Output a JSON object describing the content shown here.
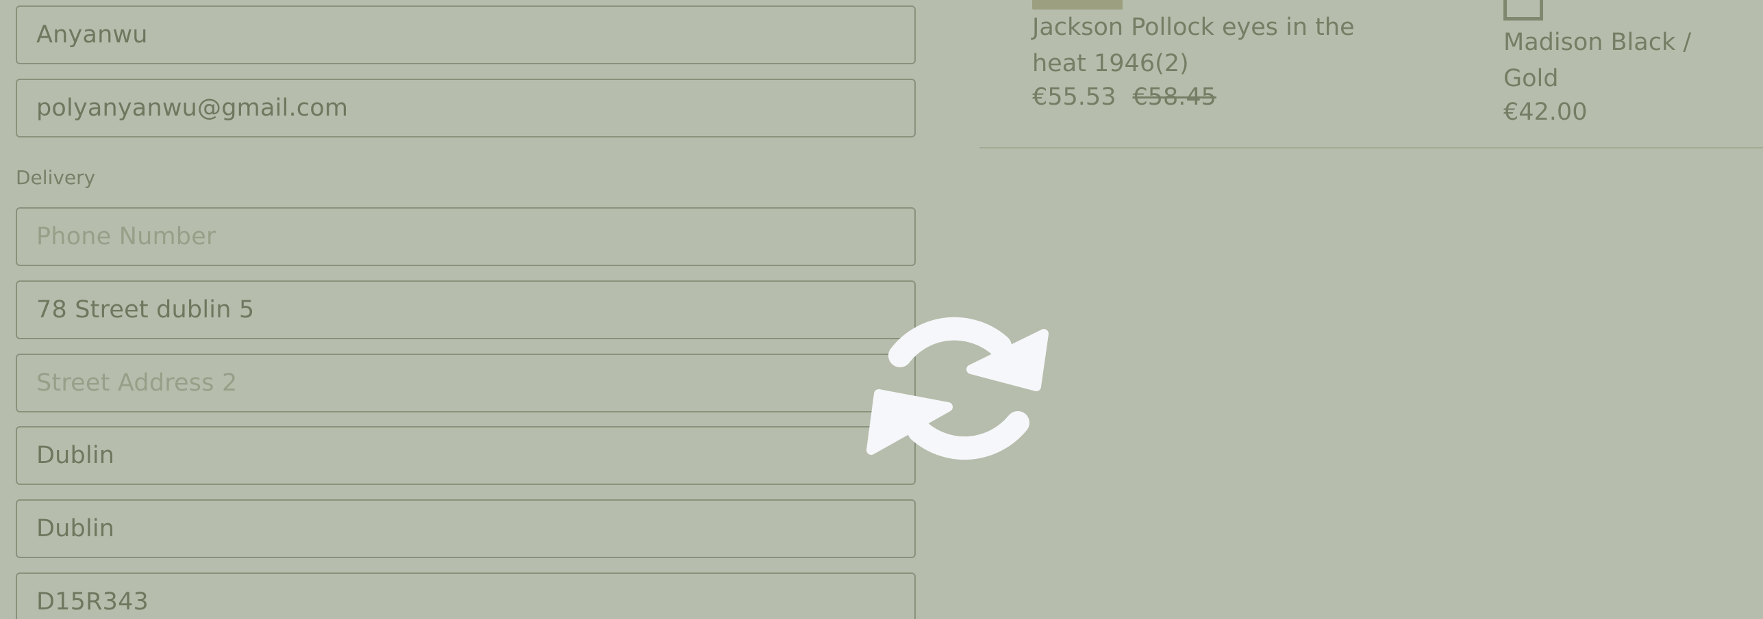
{
  "form": {
    "last_name": "Anyanwu",
    "email": "polyanyanwu@gmail.com",
    "delivery_label": "Delivery",
    "phone_placeholder": "Phone Number",
    "street_address_1": "78 Street dublin 5",
    "street_address_2_placeholder": "Street Address 2",
    "town": "Dublin",
    "county": "Dublin",
    "postcode": "D15R343"
  },
  "order_summary": {
    "product_title": "Jackson Pollock eyes in the heat 1946(2)",
    "price": "€55.53",
    "original_price": "€58.45",
    "frame_variant": "Madison Black / Gold",
    "frame_price": "€42.00"
  },
  "overlay": {
    "icon": "sync-icon",
    "overlay_color": "#707c5a",
    "icon_color": "#f5f7fa"
  }
}
